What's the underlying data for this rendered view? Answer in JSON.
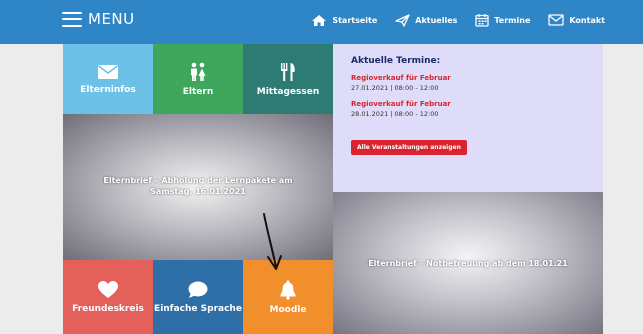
{
  "header": {
    "menu_label": "MENU",
    "nav": [
      {
        "label": "Startseite",
        "icon": "home-icon"
      },
      {
        "label": "Aktuelles",
        "icon": "paper-plane-icon"
      },
      {
        "label": "Termine",
        "icon": "calendar-icon"
      },
      {
        "label": "Kontakt",
        "icon": "envelope-icon"
      }
    ]
  },
  "tiles": {
    "elterninfos": "Elterninfos",
    "eltern": "Eltern",
    "mittagessen": "Mittagessen",
    "freundeskreis": "Freundeskreis",
    "einfache_sprache": "Einfache Sprache",
    "moodle": "Moodle"
  },
  "termine": {
    "title": "Aktuelle Termine:",
    "events": [
      {
        "title": "Regioverkauf für Februar",
        "date": "27.01.2021 | 08:00 - 12:00"
      },
      {
        "title": "Regioverkauf für Februar",
        "date": "28.01.2021 | 08:00 - 12:00"
      }
    ],
    "all_button": "Alle Veranstaltungen anzeigen"
  },
  "posts": {
    "post1": "Elternbrief – Abholung der Lernpakete am Samstag, 16.01.2021",
    "post2": "Elternbrief – Notbetreuung ab dem 18.01.21"
  },
  "colors": {
    "header": "#2f86c6",
    "elterninfos": "#6ec1e6",
    "eltern": "#3ea75c",
    "mittagessen": "#2e7b74",
    "freundeskreis": "#e4605a",
    "einfache_sprache": "#2f6fa8",
    "moodle": "#f18f2d",
    "termine_bg": "#dedcf8",
    "accent_red": "#d8242e"
  }
}
